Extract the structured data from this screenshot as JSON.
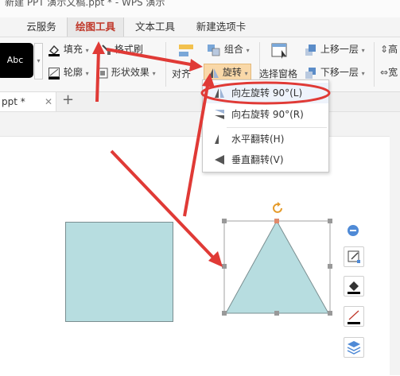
{
  "window": {
    "title": "新建 PPT 演示文稿.ppt * - WPS 演示"
  },
  "tabs": [
    {
      "label": "云服务",
      "active": false
    },
    {
      "label": "绘图工具",
      "active": true
    },
    {
      "label": "文本工具",
      "active": false
    },
    {
      "label": "新建选项卡",
      "active": false
    }
  ],
  "ribbon": {
    "style_preview": "Abc",
    "fill": "填充",
    "format_brush": "格式刷",
    "outline": "轮廓",
    "shape_effect": "形状效果",
    "align": "对齐",
    "group": "组合",
    "rotate": "旋转",
    "selection_pane": "选择窗格",
    "bring_forward": "上移一层",
    "send_backward": "下移一层",
    "height_label": "高",
    "width_label": "宽"
  },
  "document_tab": {
    "label": "ppt *"
  },
  "rotate_menu": {
    "items": [
      {
        "label": "向左旋转 90°(L)",
        "icon": "rotate-left-icon",
        "highlighted": true
      },
      {
        "label": "向右旋转 90°(R)",
        "icon": "rotate-right-icon",
        "highlighted": false
      },
      {
        "label": "水平翻转(H)",
        "icon": "flip-horizontal-icon",
        "highlighted": false
      },
      {
        "label": "垂直翻转(V)",
        "icon": "flip-vertical-icon",
        "highlighted": false
      }
    ]
  },
  "colors": {
    "accent_red": "#e03a36",
    "shape_fill": "#b7dde0",
    "active_tab_text": "#c0392b"
  }
}
